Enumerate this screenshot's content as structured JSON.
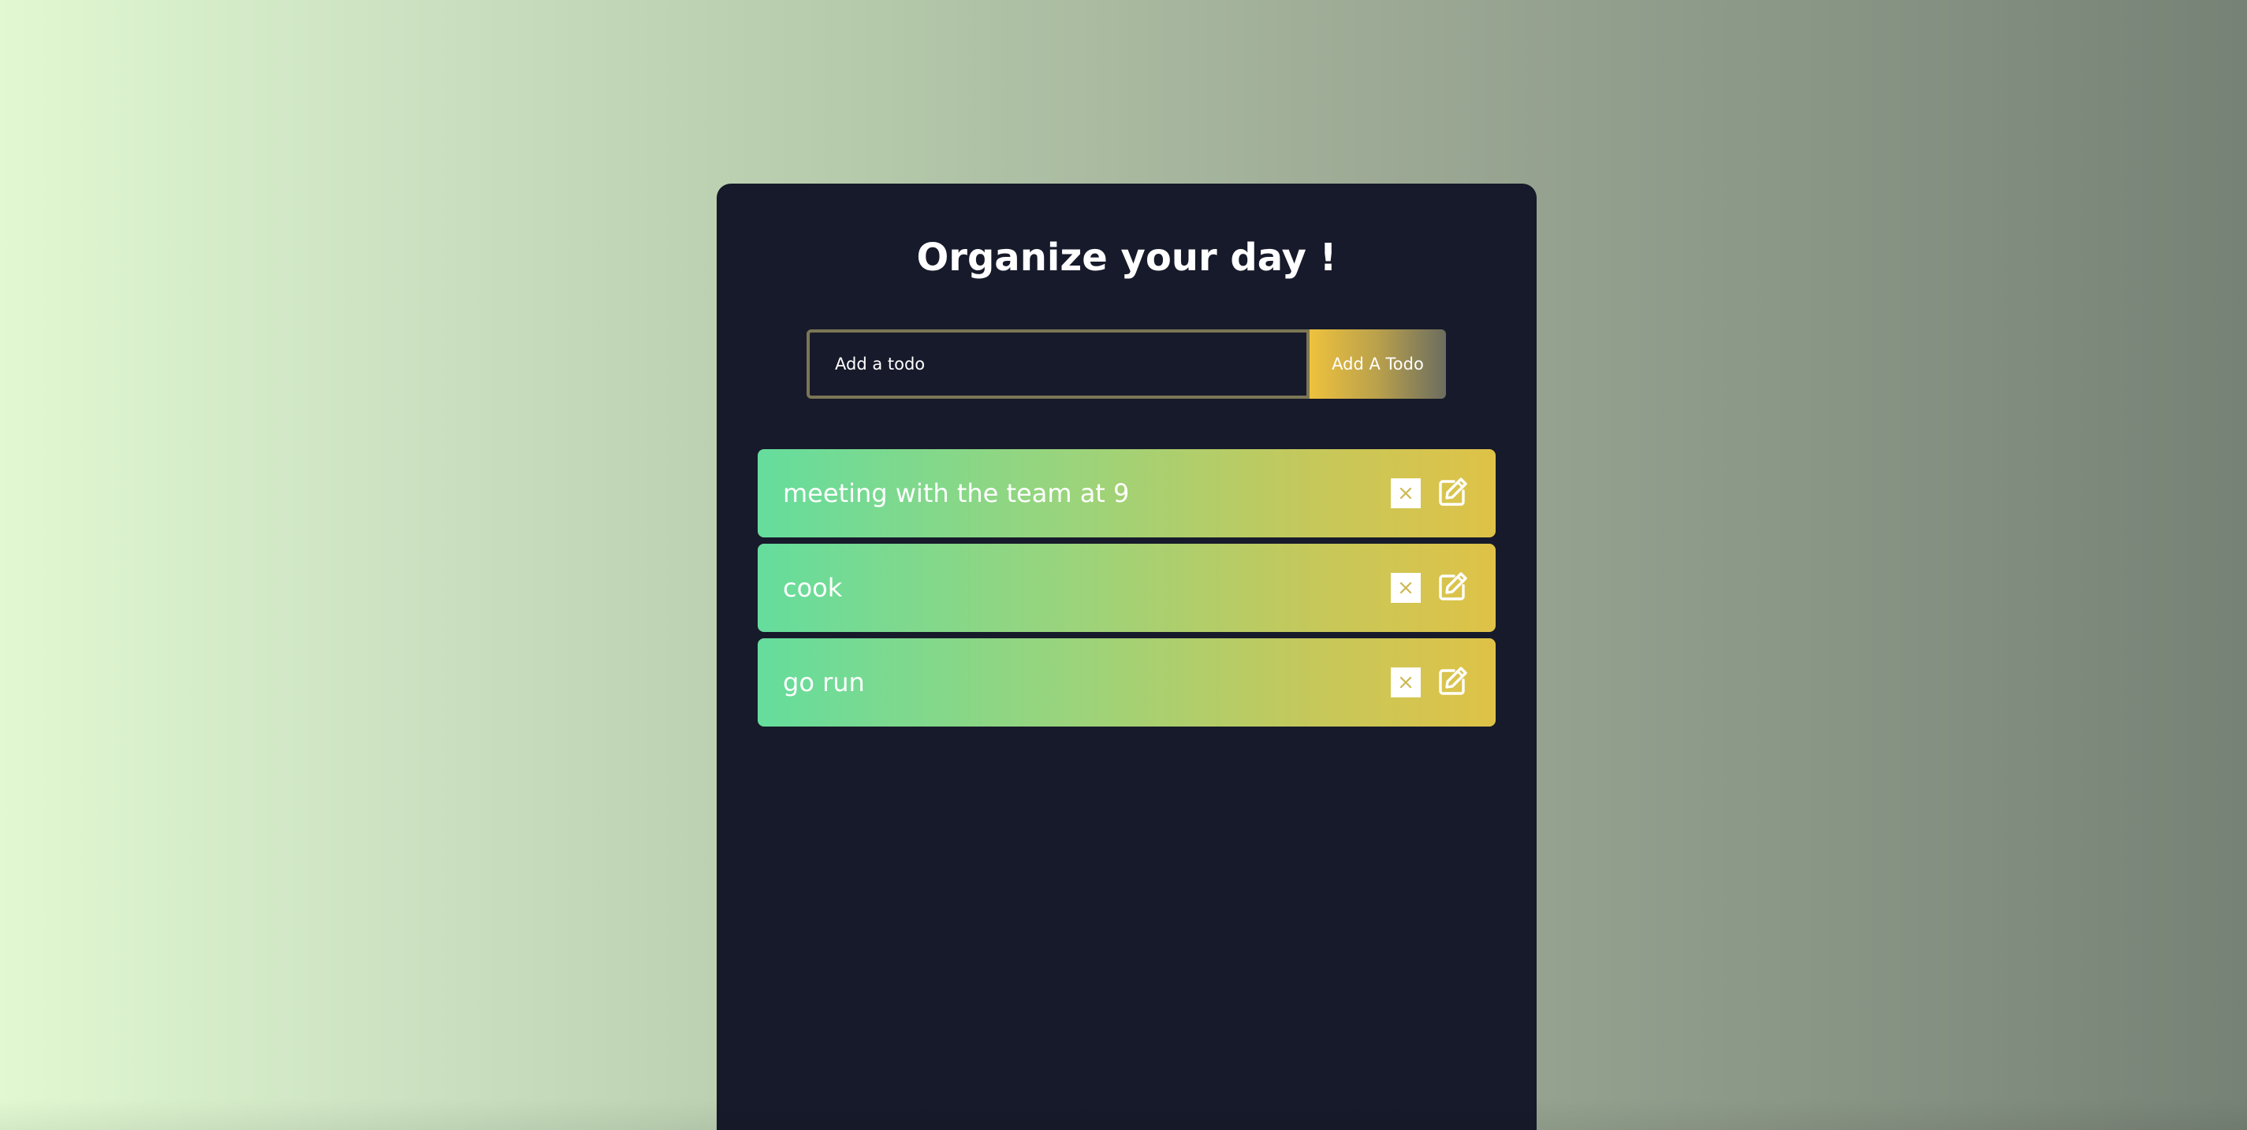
{
  "app": {
    "title": "Organize your day !"
  },
  "form": {
    "placeholder": "Add a todo",
    "value": "",
    "add_button_label": "Add A Todo"
  },
  "todos": [
    {
      "text": "meeting with the team at 9",
      "delete_icon": "close-icon",
      "edit_icon": "edit-icon"
    },
    {
      "text": "cook",
      "delete_icon": "close-icon",
      "edit_icon": "edit-icon"
    },
    {
      "text": "go run",
      "delete_icon": "close-icon",
      "edit_icon": "edit-icon"
    }
  ],
  "colors": {
    "page_gradient_start": "#e1f8d2",
    "page_gradient_end": "#768275",
    "card_background": "#171a2a",
    "input_border": "#7c7655",
    "button_gradient_start": "#eec23d",
    "button_gradient_end": "#6b6d5f",
    "todo_gradient_start": "#65dd9d",
    "todo_gradient_end": "#dfc247",
    "text": "#ffffff"
  }
}
